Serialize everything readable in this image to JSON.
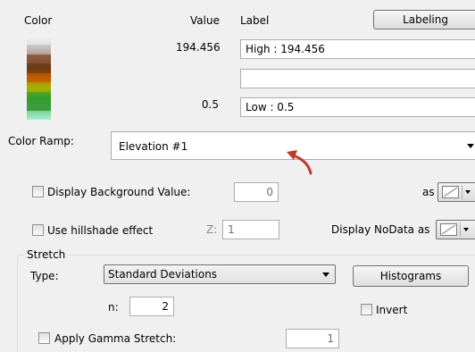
{
  "headers": {
    "color": "Color",
    "value": "Value",
    "label": "Label"
  },
  "labeling_button": "Labeling",
  "ramp_rows": {
    "high_value": "194.456",
    "high_label": "High : 194.456",
    "middle_label": "",
    "low_value": "0.5",
    "low_label": "Low : 0.5"
  },
  "color_ramp": {
    "label": "Color Ramp:",
    "selected": "Elevation #1",
    "swatch_colors": [
      "#f2f2f2",
      "#c9c4c2",
      "#8c5a3c",
      "#6b3a16",
      "#c25a00",
      "#a6b000",
      "#2f9e2f",
      "#3c9c3c",
      "#a6f2cf"
    ]
  },
  "background": {
    "checkbox_label": "Display Background Value:",
    "checked": false,
    "value": "0",
    "as_label": "as"
  },
  "hillshade": {
    "checkbox_label": "Use hillshade effect",
    "checked": false,
    "z_label": "Z:",
    "z_value": "1",
    "nodata_label": "Display NoData as"
  },
  "stretch": {
    "group_label": "Stretch",
    "type_label": "Type:",
    "type_selected": "Standard Deviations",
    "histograms_button": "Histograms",
    "n_label": "n:",
    "n_value": "2",
    "invert_label": "Invert",
    "invert_checked": false,
    "gamma_label": "Apply Gamma Stretch:",
    "gamma_checked": false,
    "gamma_value": "1"
  },
  "colors": {
    "cursor_red": "#c0392b",
    "window_bg": "#f0f0f0"
  }
}
